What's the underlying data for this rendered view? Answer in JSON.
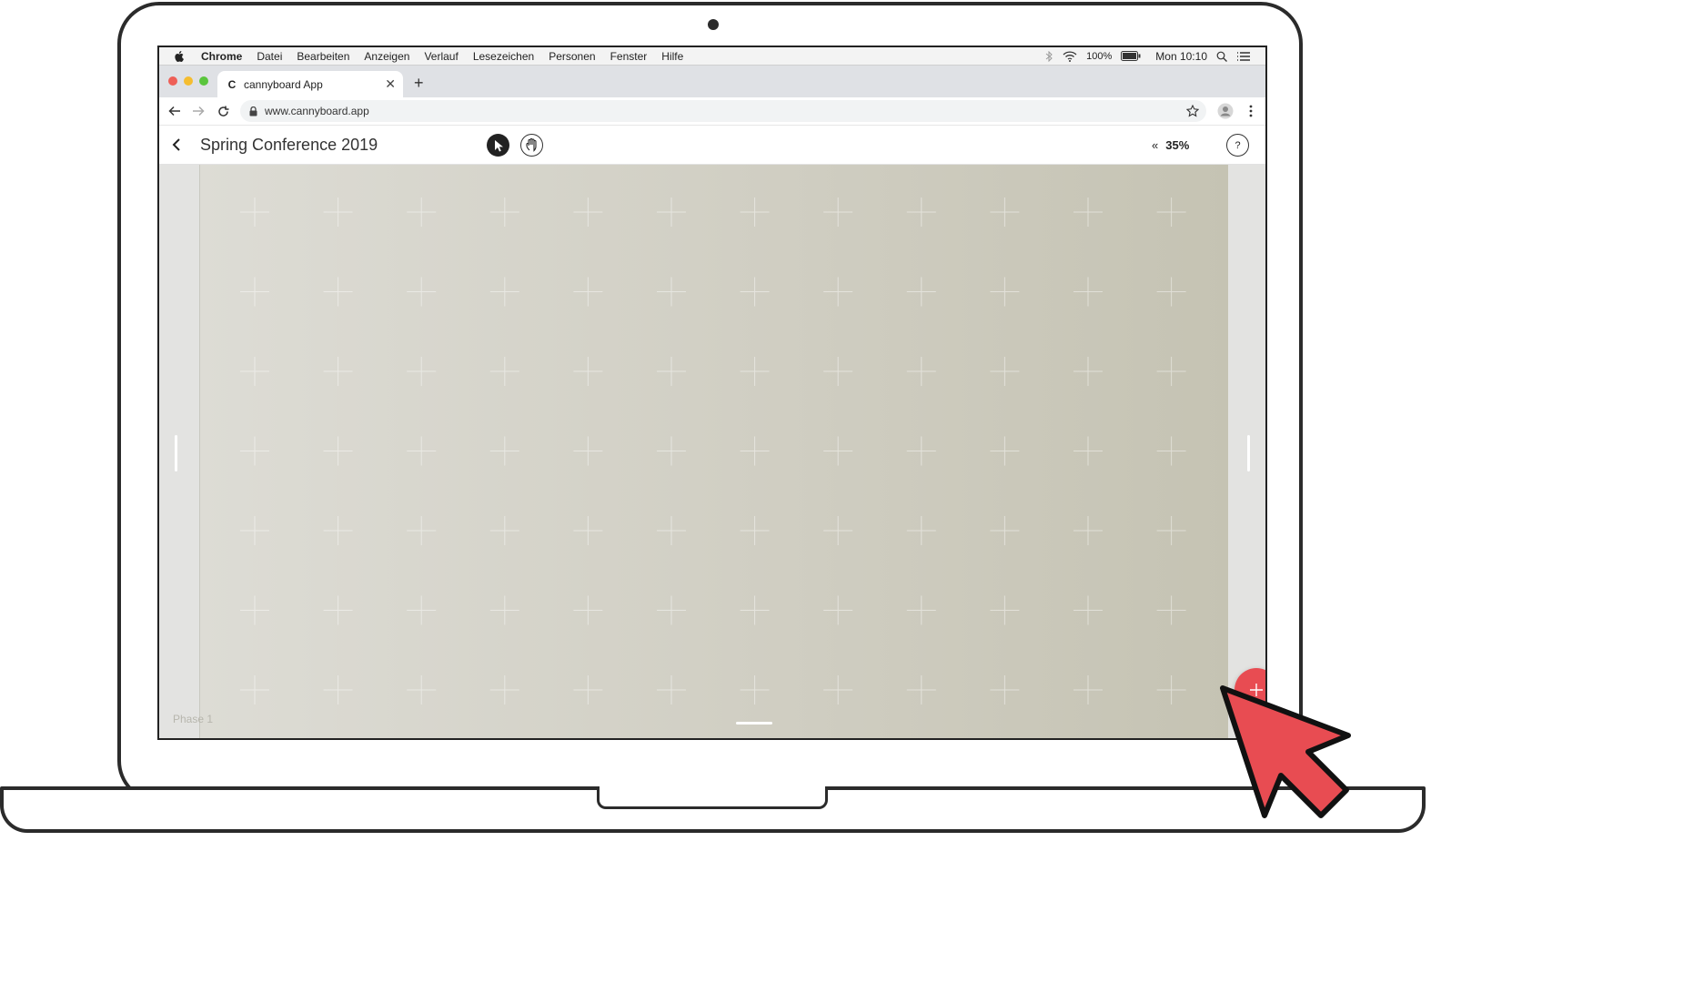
{
  "menubar": {
    "app": "Chrome",
    "items": [
      "Datei",
      "Bearbeiten",
      "Anzeigen",
      "Verlauf",
      "Lesezeichen",
      "Personen",
      "Fenster",
      "Hilfe"
    ],
    "battery": "100%",
    "clock": "Mon 10:10"
  },
  "browser": {
    "tab_title": "cannyboard App",
    "favicon": "C",
    "url": "www.cannyboard.app"
  },
  "app": {
    "title": "Spring Conference 2019",
    "zoom_icon": "«",
    "zoom": "35%",
    "help": "?",
    "phase": "Phase 1"
  },
  "colors": {
    "fab": "#e84c52",
    "pointer": "#e84c52",
    "board_left": "#dddcd5",
    "board_right": "#c5c3b3"
  },
  "icons": {
    "select_tool": "cursor-arrow-icon",
    "hand_tool": "hand-icon",
    "add": "plus-icon",
    "back": "chevron-left-icon"
  }
}
